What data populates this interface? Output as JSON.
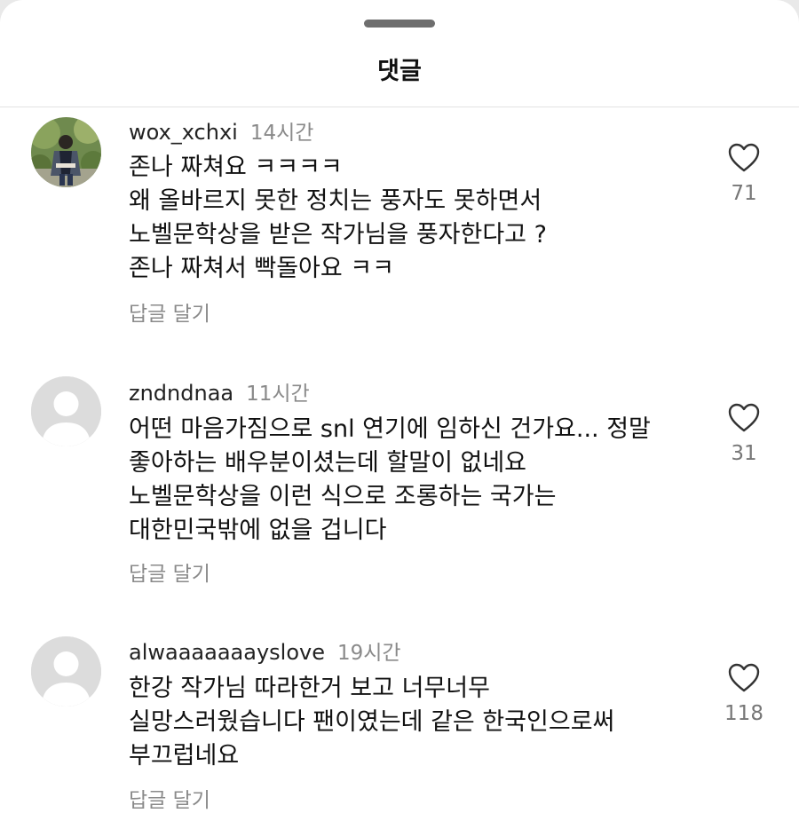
{
  "sheet": {
    "title": "댓글"
  },
  "comments": [
    {
      "username": "wox_xchxi",
      "time": "14시간",
      "lines": [
        "존나 짜쳐요 ㅋㅋㅋㅋ",
        "왜 올바르지 못한 정치는 풍자도 못하면서",
        "노벨문학상을 받은 작가님을 풍자한다고 ?",
        "존나 짜쳐서 빡돌아요 ㅋㅋ"
      ],
      "reply_label": "답글 달기",
      "likes": "71",
      "avatar": "profile-photo"
    },
    {
      "username": "zndndnaa",
      "time": "11시간",
      "lines": [
        "어떤 마음가짐으로 snl 연기에 임하신 건가요... 정말",
        "좋아하는 배우분이셨는데 할말이 없네요",
        "노벨문학상을 이런 식으로 조롱하는 국가는",
        "대한민국밖에 없을 겁니다"
      ],
      "reply_label": "답글 달기",
      "likes": "31",
      "avatar": "default-avatar"
    },
    {
      "username": "alwaaaaaaayslove",
      "time": "19시간",
      "lines": [
        "한강 작가님 따라한거 보고 너무너무",
        "실망스러웠습니다 팬이였는데 같은 한국인으로써",
        "부끄럽네요"
      ],
      "reply_label": "답글 달기",
      "likes": "118",
      "avatar": "default-avatar"
    }
  ],
  "icons": {
    "like": "heart-outline-icon"
  },
  "colors": {
    "background": "#ffffff",
    "muted_text": "#8a8a8a",
    "grabber": "#6e6e6e"
  }
}
